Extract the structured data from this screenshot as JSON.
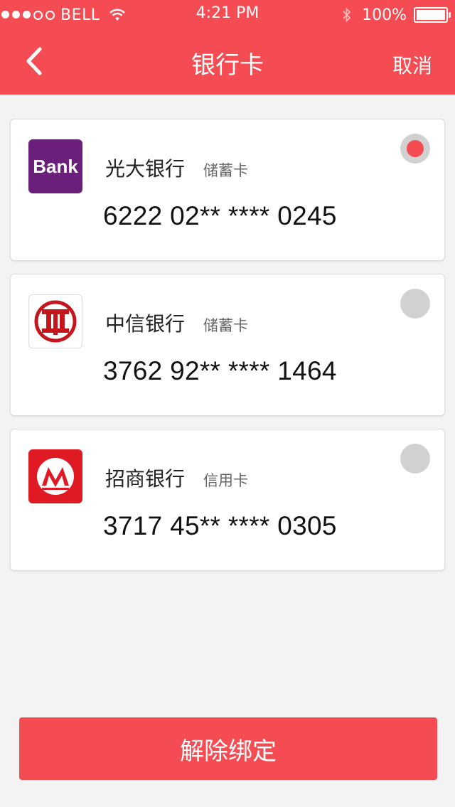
{
  "status_bar": {
    "carrier": "BELL",
    "time": "4:21 PM",
    "battery_text": "100%",
    "battery_level": 1.0
  },
  "nav": {
    "title": "银行卡",
    "cancel_label": "取消"
  },
  "cards": [
    {
      "bank_name": "光大银行",
      "card_type": "储蓄卡",
      "card_number": "6222 02** **** 0245",
      "logo_text": "Bank",
      "selected": true
    },
    {
      "bank_name": "中信银行",
      "card_type": "储蓄卡",
      "card_number": "3762 92** **** 1464",
      "selected": false
    },
    {
      "bank_name": "招商银行",
      "card_type": "信用卡",
      "card_number": "3717 45** **** 0305",
      "selected": false
    }
  ],
  "actions": {
    "unbind_label": "解除绑定"
  },
  "colors": {
    "brand_red": "#f44c52",
    "background": "#f3f3f3",
    "radio_off": "#d1d1d1"
  }
}
